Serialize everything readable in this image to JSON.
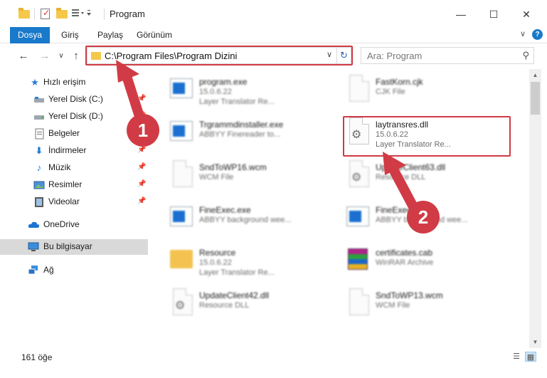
{
  "window": {
    "title": "Program",
    "minimize_symbol": "—",
    "maximize_symbol": "☐",
    "close_symbol": "✕"
  },
  "ribbon": {
    "tabs": [
      "Dosya",
      "Giriş",
      "Paylaş",
      "Görünüm"
    ],
    "collapse_symbol": "∨",
    "help_symbol": "?"
  },
  "nav": {
    "back_symbol": "←",
    "forward_symbol": "→",
    "recent_symbol": "∨",
    "up_symbol": "↑",
    "address": "C:\\Program Files\\Program Dizini",
    "address_chevron": "∨",
    "refresh_symbol": "↻",
    "search_placeholder": "Ara: Program",
    "search_symbol": "⚲"
  },
  "sidebar": {
    "items": [
      {
        "label": "Hızlı erişim",
        "icon": "star-icon",
        "pinned": false
      },
      {
        "label": "Yerel Disk (C:)",
        "icon": "drive-icon",
        "pinned": true
      },
      {
        "label": "Yerel Disk (D:)",
        "icon": "drive-icon",
        "pinned": true
      },
      {
        "label": "Belgeler",
        "icon": "documents-icon",
        "pinned": true
      },
      {
        "label": "İndirmeler",
        "icon": "download-icon",
        "pinned": true
      },
      {
        "label": "Müzik",
        "icon": "music-icon",
        "pinned": true
      },
      {
        "label": "Resimler",
        "icon": "pictures-icon",
        "pinned": true
      },
      {
        "label": "Videolar",
        "icon": "video-icon",
        "pinned": true
      },
      {
        "label": "OneDrive",
        "icon": "cloud-icon",
        "pinned": false
      },
      {
        "label": "Bu bilgisayar",
        "icon": "computer-icon",
        "pinned": false,
        "selected": true
      },
      {
        "label": "Ağ",
        "icon": "network-icon",
        "pinned": false
      }
    ],
    "pin_symbol": "📌"
  },
  "files": [
    {
      "name": "program.exe",
      "line2": "15.0.6.22",
      "line3": "Layer Translator Re...",
      "icon": "exe-icon"
    },
    {
      "name": "FastKorn.cjk",
      "line2": "CJK File",
      "line3": "",
      "icon": "document-icon"
    },
    {
      "name": "Trgrammdinstaller.exe",
      "line2": "ABBYY Finereader to...",
      "line3": "",
      "icon": "exe-icon"
    },
    {
      "name": "laytransres.dll",
      "line2": "15.0.6.22",
      "line3": "Layer Translator Re...",
      "icon": "dll-gear-icon",
      "highlighted": true
    },
    {
      "name": "SndToWP16.wcm",
      "line2": "WCM File",
      "line3": "",
      "icon": "document-icon"
    },
    {
      "name": "UpdateClient63.dll",
      "line2": "Resource DLL",
      "line3": "",
      "icon": "dll-gear-icon"
    },
    {
      "name": "FineExec.exe",
      "line2": "ABBYY background wee...",
      "line3": "",
      "icon": "exe-icon"
    },
    {
      "name": "FineExec.exe",
      "line2": "ABBYY background wee...",
      "line3": "",
      "icon": "exe-icon"
    },
    {
      "name": "Resource",
      "line2": "15.0.6.22",
      "line3": "Layer Translator Re...",
      "icon": "folder-icon"
    },
    {
      "name": "certificates.cab",
      "line2": "WinRAR Archive",
      "line3": "",
      "icon": "winrar-icon"
    },
    {
      "name": "UpdateClient42.dll",
      "line2": "Resource DLL",
      "line3": "",
      "icon": "dll-gear-icon"
    },
    {
      "name": "SndToWP13.wcm",
      "line2": "WCM File",
      "line3": "",
      "icon": "document-icon"
    }
  ],
  "status": {
    "count": "161 öğe",
    "details_view_symbol": "☰",
    "tiles_view_symbol": "▦"
  },
  "annotations": {
    "step1": "1",
    "step2": "2",
    "accent_color": "#d13b45"
  }
}
